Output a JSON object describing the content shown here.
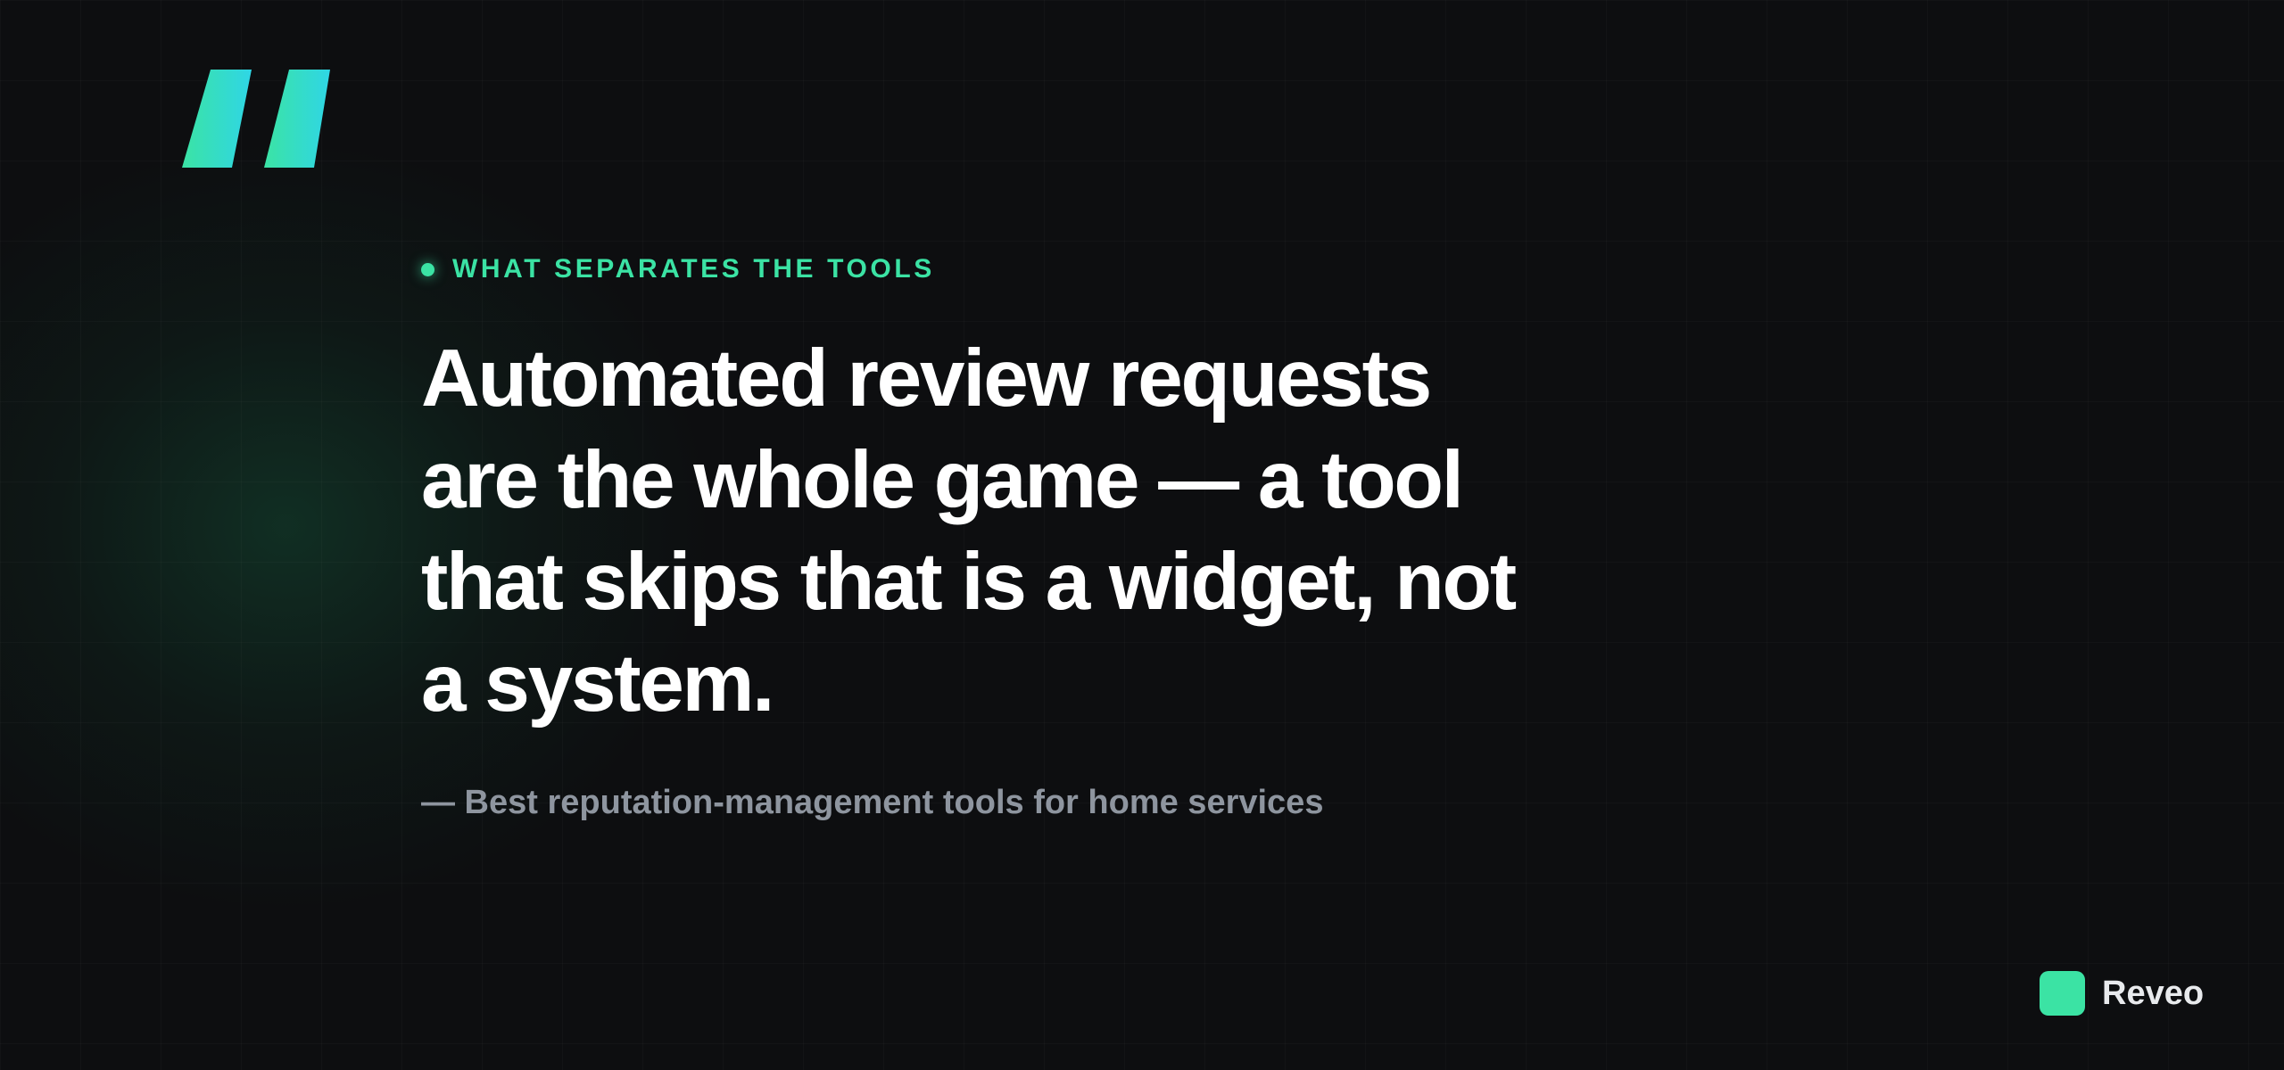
{
  "quote": {
    "icon": "quote-mark-icon",
    "eyebrow": "WHAT SEPARATES THE TOOLS",
    "headline": "Automated review requests are the whole game — a tool that skips that is a widget, not a system.",
    "attribution": "— Best reputation-management tools for home services"
  },
  "brand": {
    "name": "Reveo",
    "logo_icon": "brand-square-icon"
  },
  "colors": {
    "background": "#0d0e10",
    "accent": "#3be3a4",
    "quote_gradient_start": "#3be3a4",
    "quote_gradient_end": "#2fd6e6",
    "headline": "#ffffff",
    "attribution": "#8e959f",
    "brand_text": "#e8eaed"
  }
}
